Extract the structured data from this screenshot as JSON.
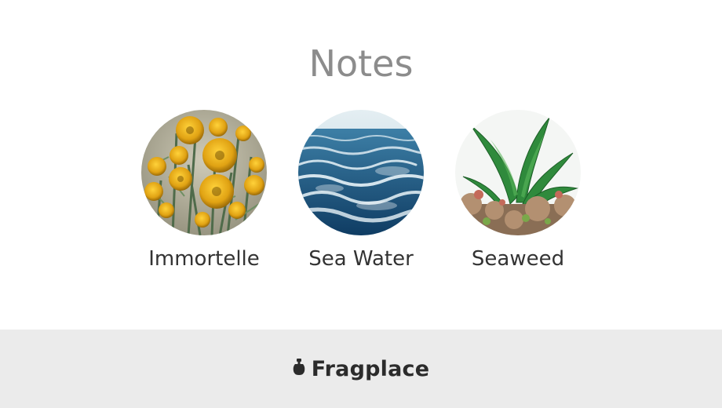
{
  "heading": "Notes",
  "notes": [
    {
      "label": "Immortelle",
      "image": "immortelle-flowers-image"
    },
    {
      "label": "Sea Water",
      "image": "sea-water-waves-image"
    },
    {
      "label": "Seaweed",
      "image": "seaweed-image"
    }
  ],
  "footer": {
    "brand": "Fragplace",
    "logo_icon": "perfume-bottle-icon"
  },
  "colors": {
    "heading": "#8c8c8c",
    "label": "#333333",
    "footer_bg": "#ebebeb",
    "brand": "#2b2b2b"
  }
}
